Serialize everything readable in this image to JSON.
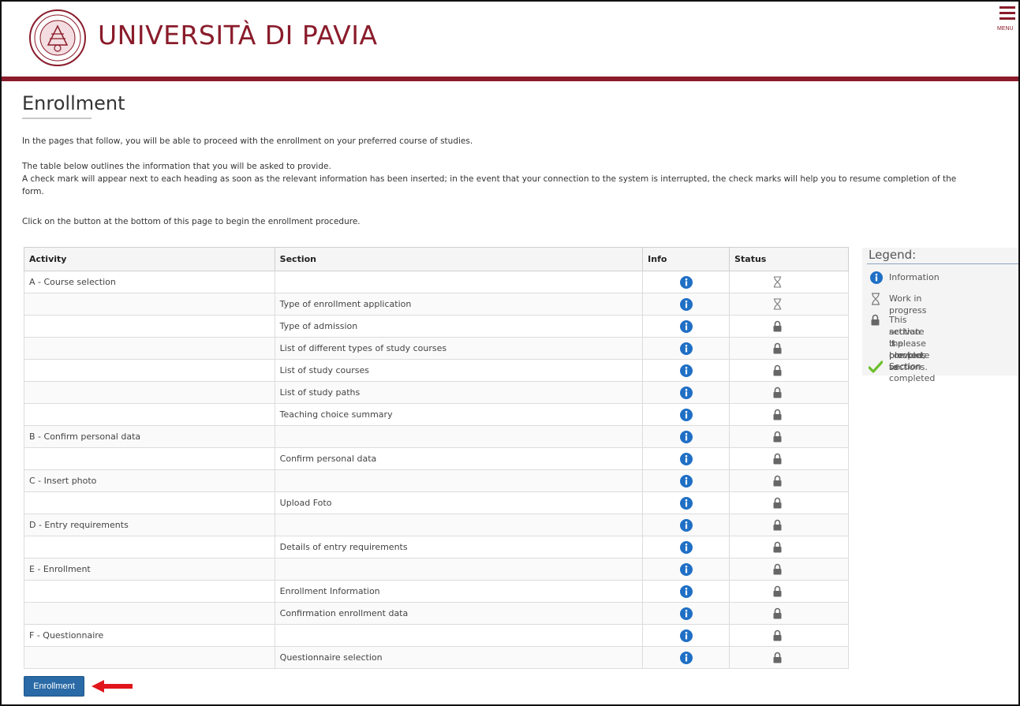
{
  "header": {
    "university_name": "UNIVERSITÀ DI PAVIA",
    "menu_label": "MENU",
    "brand_color": "#8a1c2b"
  },
  "page": {
    "title": "Enrollment",
    "intro": "In the pages that follow, you will be able to proceed with the enrollment on your preferred course of studies.",
    "table_intro_1": "The table below outlines the information that you will be asked to provide.",
    "table_intro_2": "A check mark will appear next to each heading as soon as the relevant information has been inserted; in the event that your connection to the system is interrupted, the check marks will help you to resume completion of the",
    "table_intro_3": "form.",
    "instruction": "Click on the button at the bottom of this page to begin the enrollment procedure."
  },
  "table": {
    "headers": {
      "activity": "Activity",
      "section": "Section",
      "info": "Info",
      "status": "Status"
    },
    "rows": [
      {
        "activity": "A - Course selection",
        "section": "",
        "status": "in-progress"
      },
      {
        "activity": "",
        "section": "Type of enrollment application",
        "status": "in-progress"
      },
      {
        "activity": "",
        "section": "Type of admission",
        "status": "blocked"
      },
      {
        "activity": "",
        "section": "List of different types of study courses",
        "status": "blocked"
      },
      {
        "activity": "",
        "section": "List of study courses",
        "status": "blocked"
      },
      {
        "activity": "",
        "section": "List of study paths",
        "status": "blocked"
      },
      {
        "activity": "",
        "section": "Teaching choice summary",
        "status": "blocked"
      },
      {
        "activity": "B - Confirm personal data",
        "section": "",
        "status": "blocked"
      },
      {
        "activity": "",
        "section": "Confirm personal data",
        "status": "blocked"
      },
      {
        "activity": "C - Insert photo",
        "section": "",
        "status": "blocked"
      },
      {
        "activity": "",
        "section": "Upload Foto",
        "status": "blocked"
      },
      {
        "activity": "D - Entry requirements",
        "section": "",
        "status": "blocked"
      },
      {
        "activity": "",
        "section": "Details of entry requirements",
        "status": "blocked"
      },
      {
        "activity": "E - Enrollment",
        "section": "",
        "status": "blocked"
      },
      {
        "activity": "",
        "section": "Enrollment Information",
        "status": "blocked"
      },
      {
        "activity": "",
        "section": "Confirmation enrollment data",
        "status": "blocked"
      },
      {
        "activity": "F - Questionnaire",
        "section": "",
        "status": "blocked"
      },
      {
        "activity": "",
        "section": "Questionnaire selection",
        "status": "blocked"
      }
    ]
  },
  "legend": {
    "title": "Legend:",
    "information": "Information",
    "work_in_progress": "Work in progress",
    "blocked_1": "This section is blocked, to",
    "blocked_2": "activate it please complete",
    "blocked_3": "the previous sections.",
    "completed": "Section completed"
  },
  "enroll_button": {
    "label": "Enrollment"
  },
  "icons": {
    "info": "info-circle-icon",
    "in_progress": "hourglass-icon",
    "blocked": "padlock-icon",
    "completed": "checkmark-icon",
    "arrow": "red-arrow-icon"
  },
  "colors": {
    "info_blue": "#1f6fc5",
    "button_blue": "#2a6aa6",
    "arrow_red": "#e0161b",
    "check_green": "#6cbf2c"
  }
}
